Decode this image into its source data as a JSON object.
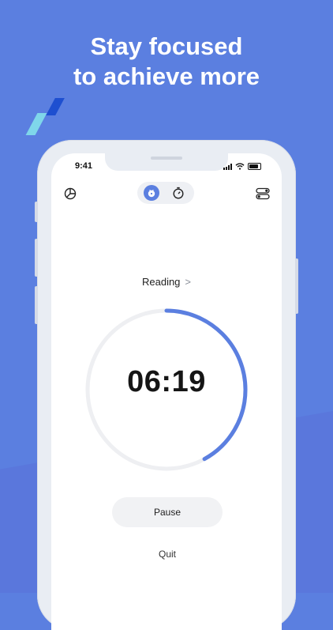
{
  "headline": {
    "line1": "Stay focused",
    "line2": "to achieve more"
  },
  "status_bar": {
    "time": "9:41"
  },
  "header": {
    "stats_icon": "pie-chart-icon",
    "focus_mode_icon": "tomato-timer-icon",
    "stopwatch_icon": "stopwatch-icon",
    "settings_icon": "toggle-settings-icon"
  },
  "task": {
    "label": "Reading",
    "chevron": ">"
  },
  "timer": {
    "display": "06:19",
    "progress": 0.42
  },
  "controls": {
    "pause_label": "Pause",
    "quit_label": "Quit"
  },
  "colors": {
    "accent": "#5b7fe0",
    "track": "#eeeff2",
    "background": "#5b7fe0"
  }
}
